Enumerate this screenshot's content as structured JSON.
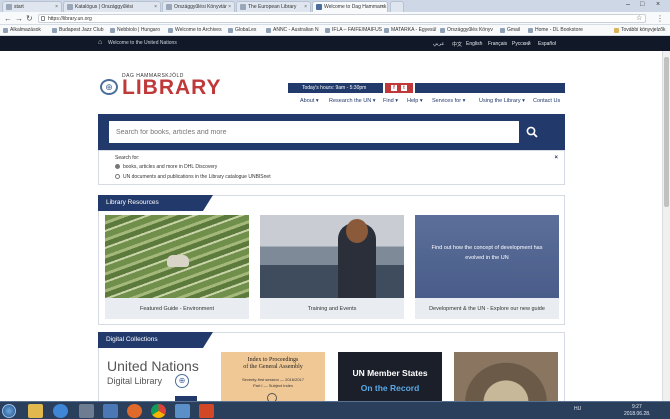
{
  "browser": {
    "tabs": [
      {
        "label": "start",
        "active": false
      },
      {
        "label": "Katalógus | Országgyűlési",
        "active": false
      },
      {
        "label": "Országgyűlési Könyvtár",
        "active": false
      },
      {
        "label": "The European Library",
        "active": false
      },
      {
        "label": "Welcome to Dag Hammarsk",
        "active": true
      }
    ],
    "url": "https://library.un.org",
    "bookmarks": [
      "Alkalmazások",
      "Budapest Jazz Club",
      "Nebbiolo | Hungaro",
      "Welcome to Archives",
      "GlobaLex",
      "ANNC - Australian N",
      "IFLA – FAIFE/MAIFUS",
      "MATARKA - Egyesül",
      "Országgyűlés Könyv",
      "Gmail",
      "Home - DL Bookstore",
      "További könyvjelzők"
    ]
  },
  "un_topbar": {
    "welcome": "Welcome to the United Nations",
    "languages": [
      "عربي",
      "中文",
      "English",
      "Français",
      "Русский",
      "Español"
    ]
  },
  "logo": {
    "small": "DAG HAMMARSKJÖLD",
    "big": "LIBRARY"
  },
  "hours": "Today's hours: 9am - 5:30pm",
  "social": [
    "f",
    "t"
  ],
  "nav": [
    "About",
    "Research the UN",
    "Find",
    "Help",
    "Services for",
    "Using the Library",
    "Contact Us"
  ],
  "search": {
    "placeholder": "Search for books, articles and more",
    "scope_label": "Search for:",
    "option1": "books, articles and more in DHL Discovery",
    "option2": "UN documents and publications in the Library catalogue UNBISnet"
  },
  "library_resources": {
    "title": "Library Resources",
    "cards": [
      {
        "caption": "Featured Guide - Environment"
      },
      {
        "caption": "Training and Events"
      },
      {
        "caption": "Development & the UN - Explore our new guide",
        "overlay": "Find out how the concept of development has evolved in the UN"
      }
    ]
  },
  "digital_collections": {
    "title": "Digital Collections",
    "items": [
      {
        "line1": "United Nations",
        "line2": "Digital Library"
      },
      {
        "line1": "Index to Proceedings",
        "line2": "of the General Assembly",
        "line3": "Seventy-first session — 2016/2017",
        "line4": "Part I — Subject Index"
      },
      {
        "line1": "UN Member States",
        "line2": "On the Record"
      },
      {
        "line1": ""
      }
    ]
  },
  "taskbar": {
    "lang": "HU",
    "time": "9:27",
    "date": "2018.06.28."
  },
  "colors": {
    "navy": "#223a6b",
    "red": "#c0393a",
    "un_bar": "#111827"
  }
}
